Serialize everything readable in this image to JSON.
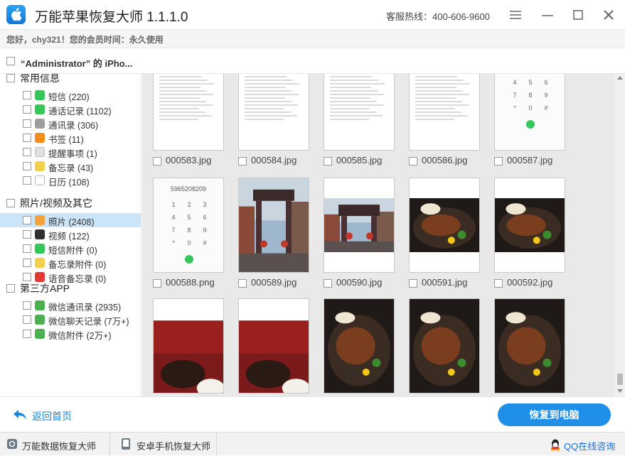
{
  "app": {
    "title": "万能苹果恢复大师  1.1.1.0",
    "hotline": "客服热线：400-606-9600"
  },
  "welcome": "您好，chy321！您的会员时间：永久使用",
  "device": {
    "name": "“Administrator” 的 iPho..."
  },
  "sidebar": {
    "groups": [
      {
        "label": "常用信息",
        "items": [
          {
            "label": "短信 (220)",
            "icon": "messages-icon",
            "color": "#35c759"
          },
          {
            "label": "通话记录 (1102)",
            "icon": "phone-icon",
            "color": "#35c759"
          },
          {
            "label": "通讯录 (306)",
            "icon": "contacts-icon",
            "color": "#9e9e9e"
          },
          {
            "label": "书签 (11)",
            "icon": "bookmark-icon",
            "color": "#f28c1b"
          },
          {
            "label": "提醒事项 (1)",
            "icon": "reminders-icon",
            "color": "#e0e0e0"
          },
          {
            "label": "备忘录 (43)",
            "icon": "notes-icon",
            "color": "#f2d04a"
          },
          {
            "label": "日历 (108)",
            "icon": "calendar-icon",
            "color": "#ffffff"
          }
        ]
      },
      {
        "label": "照片/视频及其它",
        "items": [
          {
            "label": "照片 (2408)",
            "icon": "photos-icon",
            "color": "#f6a33b",
            "selected": true
          },
          {
            "label": "视频 (122)",
            "icon": "video-icon",
            "color": "#2f2f2f"
          },
          {
            "label": "短信附件 (0)",
            "icon": "attachment-icon",
            "color": "#35c759"
          },
          {
            "label": "备忘录附件 (0)",
            "icon": "note-attachment-icon",
            "color": "#f2d04a"
          },
          {
            "label": "语音备忘录 (0)",
            "icon": "voice-memo-icon",
            "color": "#e53935"
          }
        ]
      },
      {
        "label": "第三方APP",
        "items": [
          {
            "label": "微信通讯录 (2935)",
            "icon": "wechat-icon",
            "color": "#4caf50"
          },
          {
            "label": "微信聊天记录 (7万+)",
            "icon": "wechat-icon",
            "color": "#4caf50"
          },
          {
            "label": "微信附件 (2万+)",
            "icon": "wechat-icon",
            "color": "#4caf50"
          }
        ]
      }
    ]
  },
  "photos": [
    {
      "file": "000583.jpg",
      "kind": "document"
    },
    {
      "file": "000584.jpg",
      "kind": "document"
    },
    {
      "file": "000585.jpg",
      "kind": "document"
    },
    {
      "file": "000586.jpg",
      "kind": "document"
    },
    {
      "file": "000587.jpg",
      "kind": "dialpad"
    },
    {
      "file": "000588.png",
      "kind": "dialpad",
      "number": "5965208209"
    },
    {
      "file": "000589.jpg",
      "kind": "street"
    },
    {
      "file": "000590.jpg",
      "kind": "street"
    },
    {
      "file": "000591.jpg",
      "kind": "food"
    },
    {
      "file": "000592.jpg",
      "kind": "food"
    },
    {
      "file": "",
      "kind": "restaurant"
    },
    {
      "file": "",
      "kind": "restaurant"
    },
    {
      "file": "",
      "kind": "food"
    },
    {
      "file": "",
      "kind": "food"
    },
    {
      "file": "",
      "kind": "food"
    }
  ],
  "footer": {
    "back_label": "返回首页",
    "recover_label": "恢复到电脑"
  },
  "bottom": {
    "tab1": "万能数据恢复大师",
    "tab2": "安卓手机恢复大师",
    "qq": "QQ在线咨询"
  }
}
